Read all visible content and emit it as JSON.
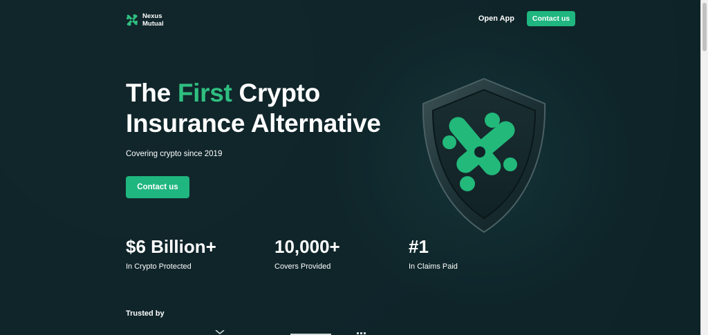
{
  "brand": {
    "name_line1": "Nexus",
    "name_line2": "Mutual",
    "logo_icon": "nexus-logo-icon",
    "accent_color": "#1fb67f",
    "background_color": "#0d2328"
  },
  "nav": {
    "open_app_label": "Open App",
    "contact_label": "Contact us"
  },
  "hero": {
    "title_part1": "The ",
    "title_accent": "First",
    "title_part2": " Crypto",
    "title_line2": "Insurance Alternative",
    "subtitle": "Covering crypto since 2019",
    "cta_label": "Contact us",
    "illustration_icon": "shield-icon"
  },
  "stats": [
    {
      "value": "$6 Billion+",
      "label": "In Crypto Protected"
    },
    {
      "value": "10,000+",
      "label": "Covers Provided"
    },
    {
      "value": "#1",
      "label": "In Claims Paid"
    }
  ],
  "trusted": {
    "label": "Trusted by"
  }
}
